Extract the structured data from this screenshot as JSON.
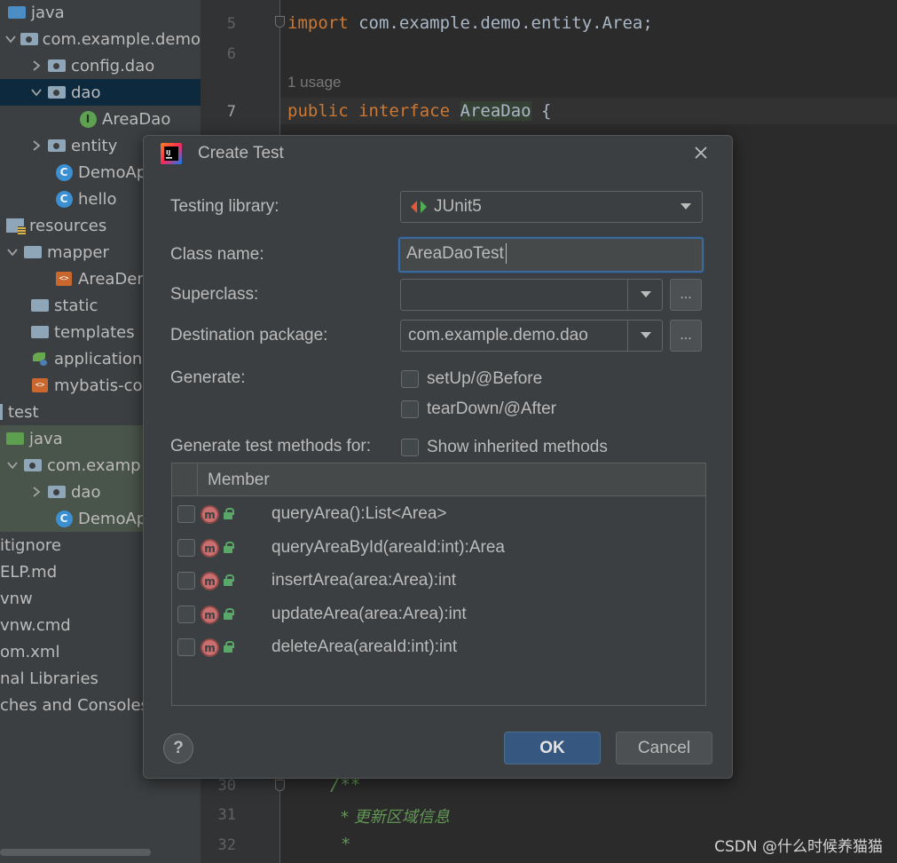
{
  "project_tree": {
    "items": [
      {
        "label": "java",
        "icon": "source-folder-icon"
      },
      {
        "label": "com.example.demo",
        "icon": "package-icon"
      },
      {
        "label": "config.dao",
        "icon": "package-icon"
      },
      {
        "label": "dao",
        "icon": "package-icon"
      },
      {
        "label": "AreaDao",
        "icon": "interface-icon",
        "badge": "I"
      },
      {
        "label": "entity",
        "icon": "package-icon"
      },
      {
        "label": "DemoAp",
        "icon": "spring-class-icon",
        "badge": "C"
      },
      {
        "label": "hello",
        "icon": "class-icon",
        "badge": "C"
      },
      {
        "label": "resources",
        "icon": "resources-folder-icon"
      },
      {
        "label": "mapper",
        "icon": "folder-icon"
      },
      {
        "label": "AreaDen",
        "icon": "xml-file-icon"
      },
      {
        "label": "static",
        "icon": "folder-icon"
      },
      {
        "label": "templates",
        "icon": "folder-icon"
      },
      {
        "label": "application.",
        "icon": "spring-config-icon"
      },
      {
        "label": "mybatis-con",
        "icon": "xml-file-icon"
      },
      {
        "label": "test",
        "icon": "none"
      },
      {
        "label": "java",
        "icon": "test-source-folder-icon"
      },
      {
        "label": "com.examp",
        "icon": "package-icon"
      },
      {
        "label": "dao",
        "icon": "package-icon"
      },
      {
        "label": "DemoAp",
        "icon": "spring-class-icon",
        "badge": "C"
      },
      {
        "label": "itignore",
        "icon": "none"
      },
      {
        "label": "ELP.md",
        "icon": "none"
      },
      {
        "label": "vnw",
        "icon": "none"
      },
      {
        "label": "vnw.cmd",
        "icon": "none"
      },
      {
        "label": "om.xml",
        "icon": "none"
      },
      {
        "label": "nal Libraries",
        "icon": "none"
      },
      {
        "label": "ches and Consoles",
        "icon": "none"
      }
    ]
  },
  "editor": {
    "line_numbers": [
      "5",
      "6",
      "7",
      "30",
      "31",
      "32"
    ],
    "import_keyword": "import",
    "import_path": " com.example.demo.entity.Area;",
    "usage_hint": "1 usage",
    "decl_public": "public",
    "decl_interface": "interface",
    "decl_name": "AreaDao",
    "decl_brace": " {",
    "comment_open": "/**",
    "comment_line1": "* 更新区域信息",
    "comment_line2": "*"
  },
  "dialog": {
    "title": "Create Test",
    "testing_library_label": "Testing library:",
    "testing_library_value": "JUnit5",
    "class_name_label": "Class name:",
    "class_name_value": "AreaDaoTest",
    "superclass_label": "Superclass:",
    "superclass_value": "",
    "browse_label": "...",
    "destination_label": "Destination package:",
    "destination_value": "com.example.demo.dao",
    "generate_label": "Generate:",
    "setup_label": "setUp/@Before",
    "teardown_label": "tearDown/@After",
    "methods_for_label": "Generate test methods for:",
    "show_inherited_label": "Show inherited methods",
    "member_header": "Member",
    "method_badge": "m",
    "members": [
      "queryArea():List<Area>",
      "queryAreaById(areaId:int):Area",
      "insertArea(area:Area):int",
      "updateArea(area:Area):int",
      "deleteArea(areaId:int):int"
    ],
    "help_label": "?",
    "ok_label": "OK",
    "cancel_label": "Cancel"
  },
  "watermark": "CSDN @什么时候养猫猫",
  "colors": {
    "keyword": "#cc7832",
    "comment": "#629755",
    "selection": "#0d293e",
    "accent_button": "#365880",
    "focus_border": "#3d6a9e"
  }
}
